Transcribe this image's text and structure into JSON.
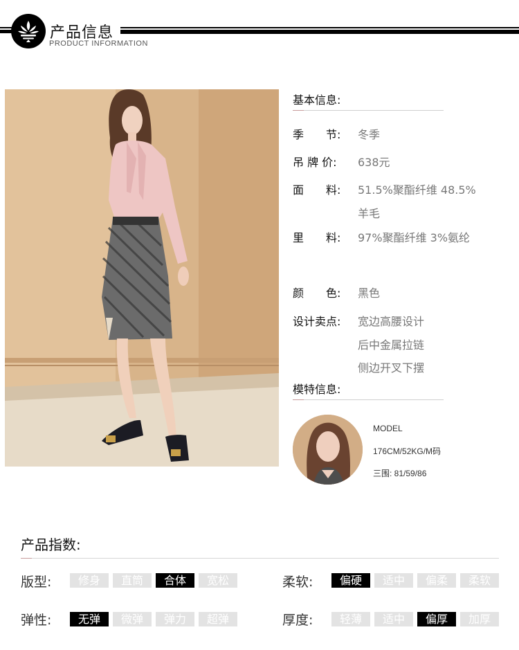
{
  "header": {
    "title": "产品信息",
    "subtitle": "PRODUCT INFORMATION"
  },
  "basic_info": {
    "title": "基本信息:",
    "rows": [
      {
        "label": "季　　节:",
        "lines": [
          "冬季"
        ]
      },
      {
        "label": "吊 牌 价:",
        "lines": [
          "638元"
        ]
      },
      {
        "label": "面　　料:",
        "lines": [
          "51.5%聚酯纤维 48.5%",
          "羊毛"
        ]
      },
      {
        "label": "里　　料:",
        "lines": [
          "97%聚酯纤维 3%氨纶"
        ]
      },
      {
        "label": "颜　　色:",
        "lines": [
          "黑色"
        ]
      },
      {
        "label": "设计卖点:",
        "lines": [
          "宽边高腰设计",
          "后中金属拉链",
          "侧边开叉下摆"
        ]
      }
    ]
  },
  "model_info": {
    "title": "模特信息:",
    "line1": "MODEL",
    "line2": "176CM/52KG/M码",
    "line3": "三围: 81/59/86"
  },
  "index": {
    "title": "产品指数:",
    "groups": [
      {
        "label": "版型:",
        "options": [
          "修身",
          "直筒",
          "合体",
          "宽松"
        ],
        "selected": 2
      },
      {
        "label": "柔软:",
        "options": [
          "偏硬",
          "适中",
          "偏柔",
          "柔软"
        ],
        "selected": 0
      },
      {
        "label": "弹性:",
        "options": [
          "无弹",
          "微弹",
          "弹力",
          "超弹"
        ],
        "selected": 0
      },
      {
        "label": "厚度:",
        "options": [
          "轻薄",
          "适中",
          "偏厚",
          "加厚"
        ],
        "selected": 2
      }
    ]
  },
  "colors": {
    "accent": "#000000",
    "chip_inactive": "#e3e3e3",
    "line_accent": "#c79b9b",
    "value_text": "#777777"
  }
}
